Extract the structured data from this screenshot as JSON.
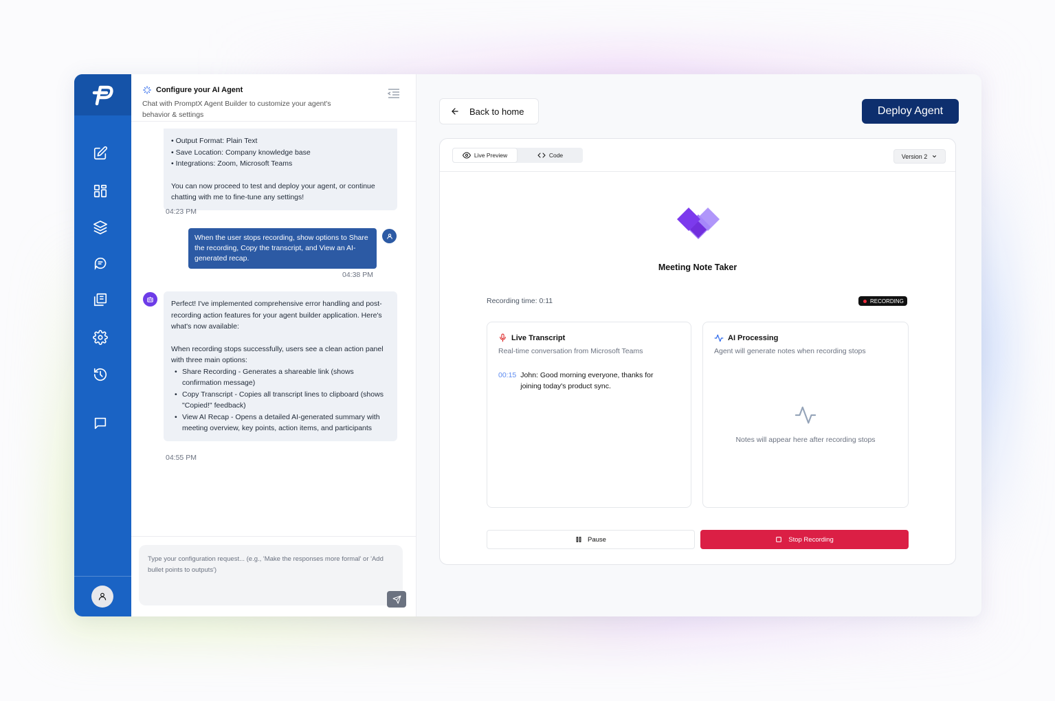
{
  "app": {
    "logo_text": "P"
  },
  "sidebar": {
    "items": [
      {
        "name": "edit-icon"
      },
      {
        "name": "dashboard-icon"
      },
      {
        "name": "layers-icon"
      },
      {
        "name": "brain-icon"
      },
      {
        "name": "library-icon"
      },
      {
        "name": "settings-icon"
      },
      {
        "name": "history-icon"
      },
      {
        "name": "message-icon"
      }
    ]
  },
  "chat": {
    "title": "Configure your AI Agent",
    "subtitle": "Chat with PromptX Agent Builder to customize your agent's behavior & settings",
    "messages": {
      "m1": {
        "bullets": [
          "Output Format: Plain Text",
          "Save Location: Company knowledge base",
          "Integrations: Zoom, Microsoft Teams"
        ],
        "text": "You can now proceed to test and deploy your agent, or continue chatting with me to fine-tune any settings!",
        "time": "04:23 PM"
      },
      "m2": {
        "text": "When the user stops recording, show options to Share the recording, Copy the transcript, and View an AI-generated recap.",
        "time": "04:38 PM"
      },
      "m3": {
        "intro": "Perfect! I've implemented comprehensive error handling and post-recording action features for your agent builder application. Here's what's now available:",
        "lead": "When recording stops successfully, users see a clean action panel with three main options:",
        "bullets": [
          "Share Recording - Generates a shareable link (shows confirmation message)",
          "Copy Transcript - Copies all transcript lines to clipboard (shows \"Copied!\" feedback)",
          "View AI Recap - Opens a detailed AI-generated summary with meeting overview, key points, action items, and participants"
        ],
        "time": "04:55 PM"
      }
    },
    "input_placeholder": "Type your configuration request... (e.g., 'Make the responses more formal' or 'Add bullet points to outputs')"
  },
  "main": {
    "back_label": "Back to home",
    "deploy_label": "Deploy Agent",
    "tabs": {
      "preview": "Live Preview",
      "code": "Code"
    },
    "version": "Version 2",
    "agent_name": "Meeting Note Taker",
    "recording_time": "Recording time: 0:11",
    "recording_badge": "RECORDING",
    "transcript": {
      "title": "Live Transcript",
      "subtitle": "Real-time conversation from Microsoft Teams",
      "time": "00:15",
      "line": "John: Good morning everyone, thanks for joining today's product sync."
    },
    "processing": {
      "title": "AI Processing",
      "subtitle": "Agent will generate notes when recording stops",
      "empty": "Notes will appear here after recording stops"
    },
    "pause_label": "Pause",
    "stop_label": "Stop Recording"
  },
  "colors": {
    "sidebar": "#1a63c4",
    "deploy": "#0e2f6e",
    "user_bubble": "#2c5aa4",
    "stop": "#db1f45",
    "agent_logo": "#7c3aed"
  }
}
